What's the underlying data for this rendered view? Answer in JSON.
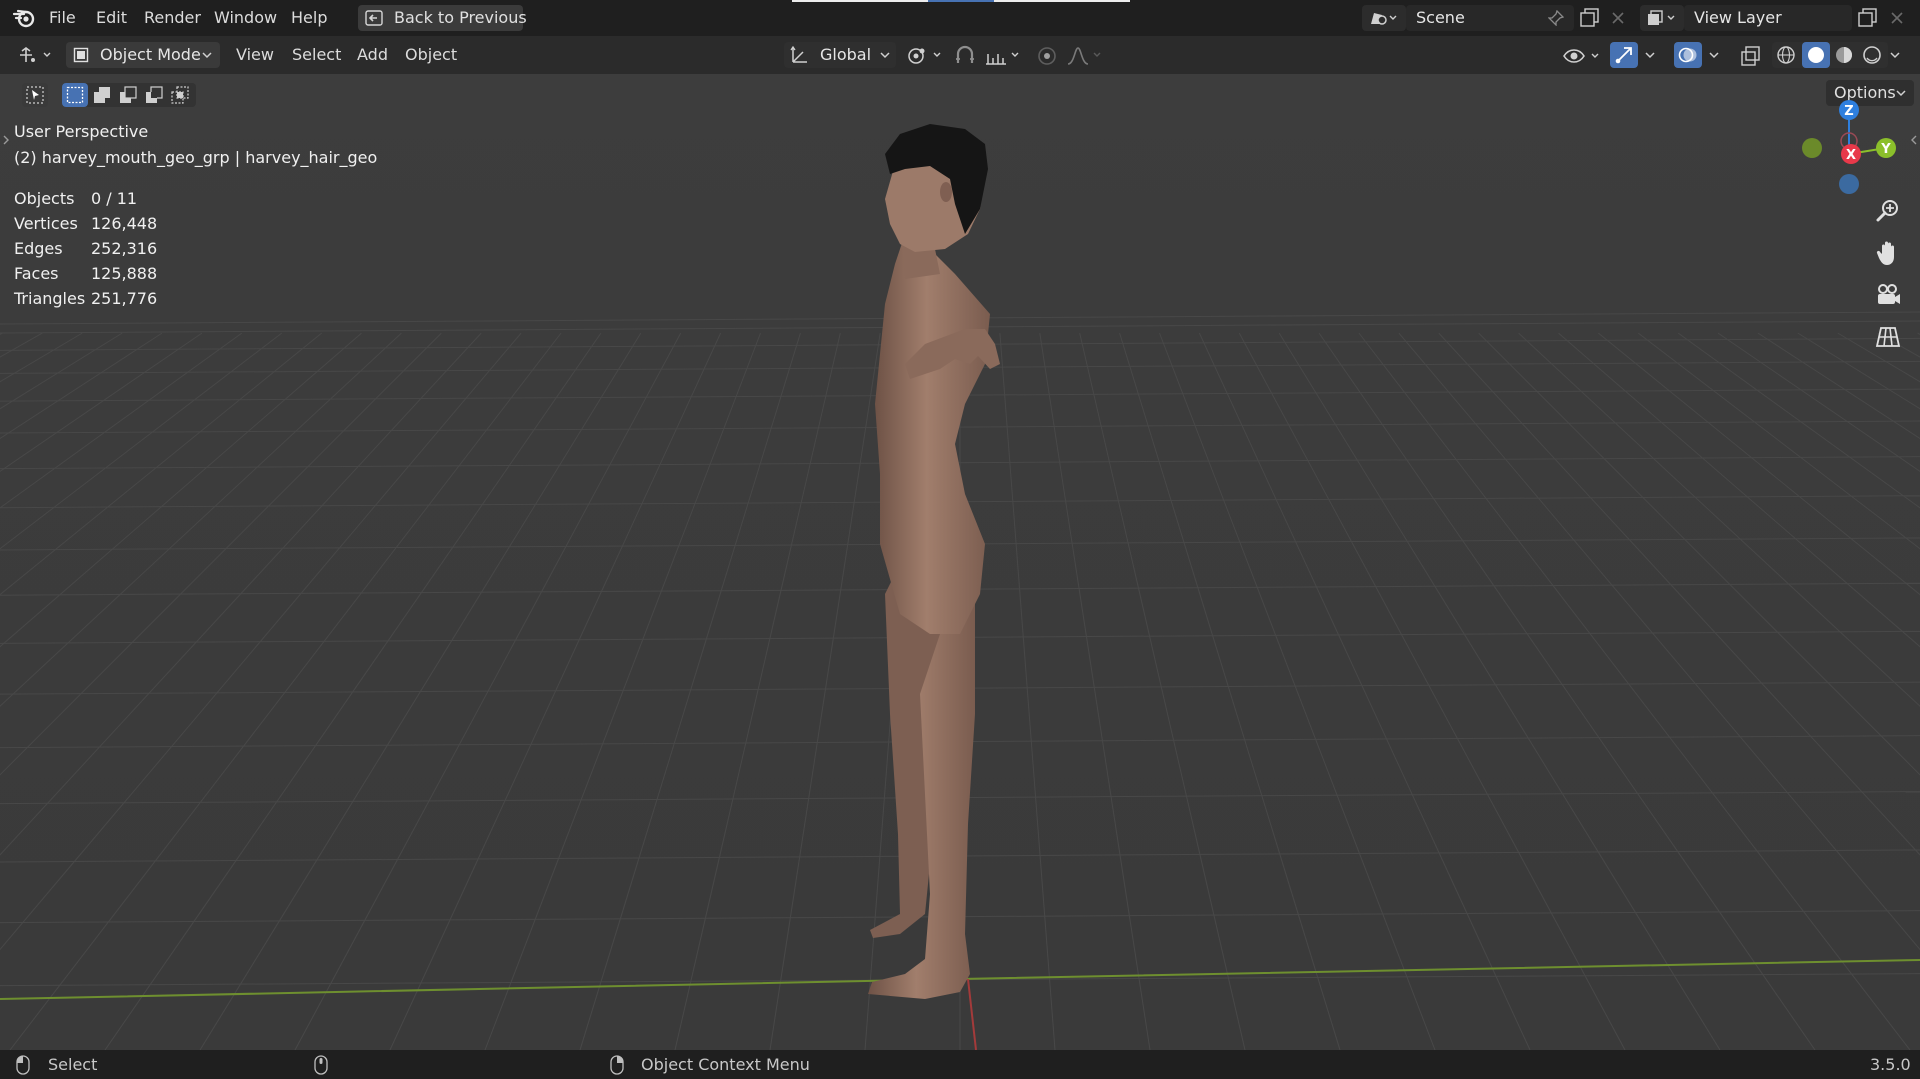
{
  "menu": {
    "items": [
      "File",
      "Edit",
      "Render",
      "Window",
      "Help"
    ],
    "back_button": "Back to Previous"
  },
  "scene": {
    "label": "Scene",
    "view_layer": "View Layer"
  },
  "header": {
    "mode": "Object Mode",
    "menus": [
      "View",
      "Select",
      "Add",
      "Object"
    ],
    "transform_orientation": "Global",
    "options_label": "Options"
  },
  "viewport": {
    "perspective": "User Perspective",
    "active_object": "(2) harvey_mouth_geo_grp | harvey_hair_geo",
    "stats": [
      {
        "label": "Objects",
        "value": "0 / 11"
      },
      {
        "label": "Vertices",
        "value": "126,448"
      },
      {
        "label": "Edges",
        "value": "252,316"
      },
      {
        "label": "Faces",
        "value": "125,888"
      },
      {
        "label": "Triangles",
        "value": "251,776"
      }
    ],
    "gizmo": {
      "z": "Z",
      "x": "X",
      "y": "Y"
    }
  },
  "status": {
    "select": "Select",
    "context_menu": "Object Context Menu",
    "version": "3.5.0"
  },
  "colors": {
    "accent": "#4772b3",
    "x_axis": "#e8394a",
    "y_axis": "#8bbf2b",
    "z_axis": "#2e7fde",
    "skin": "#9b7766",
    "hair": "#151515"
  },
  "icons": [
    "blender-logo-icon",
    "back-arrow-icon",
    "scene-icon",
    "pin-icon",
    "duplicate-icon",
    "close-icon",
    "view-layer-icon",
    "editor-type-icon",
    "object-mode-icon",
    "transform-orientation-icon",
    "pivot-icon",
    "snap-icon",
    "snap-increment-icon",
    "proportional-edit-icon",
    "falloff-icon",
    "visibility-icon",
    "gizmo-icon",
    "overlay-icon",
    "xray-icon",
    "wireframe-shading-icon",
    "solid-shading-icon",
    "material-shading-icon",
    "rendered-shading-icon",
    "select-tool-icon",
    "select-box-icon",
    "select-extend-icon",
    "select-subtract-icon",
    "select-difference-icon",
    "select-intersect-icon",
    "zoom-icon",
    "hand-icon",
    "camera-icon",
    "grid-icon",
    "mouse-left-icon",
    "mouse-middle-icon",
    "mouse-right-icon"
  ]
}
